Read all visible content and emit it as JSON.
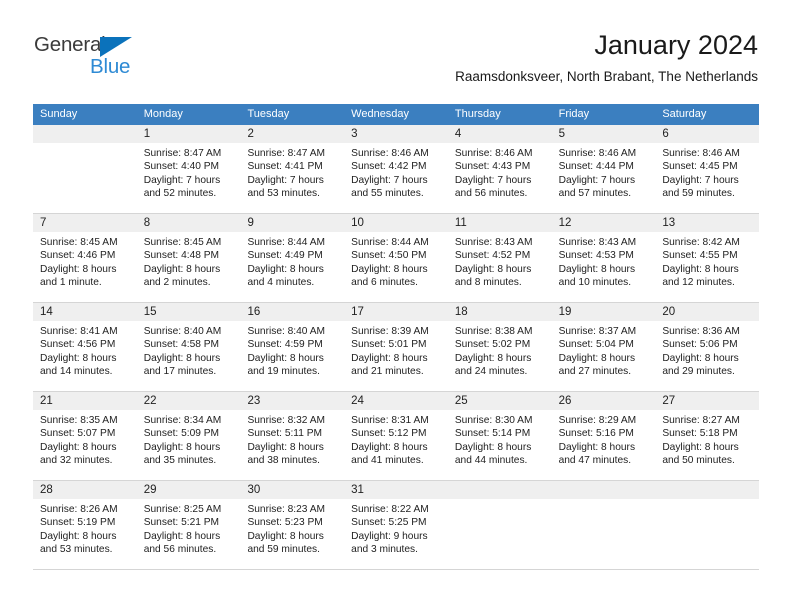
{
  "brand": {
    "name_part1": "General",
    "name_part2": "Blue",
    "color_dark": "#3b3b3b",
    "color_blue": "#2e8ad4",
    "triangle_color": "#0b72bb"
  },
  "header": {
    "title": "January 2024",
    "subtitle": "Raamsdonksveer, North Brabant, The Netherlands"
  },
  "calendar": {
    "header_bg": "#3b7fc0",
    "daynum_bg": "#efefef",
    "weekdays": [
      "Sunday",
      "Monday",
      "Tuesday",
      "Wednesday",
      "Thursday",
      "Friday",
      "Saturday"
    ],
    "weeks": [
      [
        {
          "day": "",
          "lines": []
        },
        {
          "day": "1",
          "lines": [
            "Sunrise: 8:47 AM",
            "Sunset: 4:40 PM",
            "Daylight: 7 hours",
            "and 52 minutes."
          ]
        },
        {
          "day": "2",
          "lines": [
            "Sunrise: 8:47 AM",
            "Sunset: 4:41 PM",
            "Daylight: 7 hours",
            "and 53 minutes."
          ]
        },
        {
          "day": "3",
          "lines": [
            "Sunrise: 8:46 AM",
            "Sunset: 4:42 PM",
            "Daylight: 7 hours",
            "and 55 minutes."
          ]
        },
        {
          "day": "4",
          "lines": [
            "Sunrise: 8:46 AM",
            "Sunset: 4:43 PM",
            "Daylight: 7 hours",
            "and 56 minutes."
          ]
        },
        {
          "day": "5",
          "lines": [
            "Sunrise: 8:46 AM",
            "Sunset: 4:44 PM",
            "Daylight: 7 hours",
            "and 57 minutes."
          ]
        },
        {
          "day": "6",
          "lines": [
            "Sunrise: 8:46 AM",
            "Sunset: 4:45 PM",
            "Daylight: 7 hours",
            "and 59 minutes."
          ]
        }
      ],
      [
        {
          "day": "7",
          "lines": [
            "Sunrise: 8:45 AM",
            "Sunset: 4:46 PM",
            "Daylight: 8 hours",
            "and 1 minute."
          ]
        },
        {
          "day": "8",
          "lines": [
            "Sunrise: 8:45 AM",
            "Sunset: 4:48 PM",
            "Daylight: 8 hours",
            "and 2 minutes."
          ]
        },
        {
          "day": "9",
          "lines": [
            "Sunrise: 8:44 AM",
            "Sunset: 4:49 PM",
            "Daylight: 8 hours",
            "and 4 minutes."
          ]
        },
        {
          "day": "10",
          "lines": [
            "Sunrise: 8:44 AM",
            "Sunset: 4:50 PM",
            "Daylight: 8 hours",
            "and 6 minutes."
          ]
        },
        {
          "day": "11",
          "lines": [
            "Sunrise: 8:43 AM",
            "Sunset: 4:52 PM",
            "Daylight: 8 hours",
            "and 8 minutes."
          ]
        },
        {
          "day": "12",
          "lines": [
            "Sunrise: 8:43 AM",
            "Sunset: 4:53 PM",
            "Daylight: 8 hours",
            "and 10 minutes."
          ]
        },
        {
          "day": "13",
          "lines": [
            "Sunrise: 8:42 AM",
            "Sunset: 4:55 PM",
            "Daylight: 8 hours",
            "and 12 minutes."
          ]
        }
      ],
      [
        {
          "day": "14",
          "lines": [
            "Sunrise: 8:41 AM",
            "Sunset: 4:56 PM",
            "Daylight: 8 hours",
            "and 14 minutes."
          ]
        },
        {
          "day": "15",
          "lines": [
            "Sunrise: 8:40 AM",
            "Sunset: 4:58 PM",
            "Daylight: 8 hours",
            "and 17 minutes."
          ]
        },
        {
          "day": "16",
          "lines": [
            "Sunrise: 8:40 AM",
            "Sunset: 4:59 PM",
            "Daylight: 8 hours",
            "and 19 minutes."
          ]
        },
        {
          "day": "17",
          "lines": [
            "Sunrise: 8:39 AM",
            "Sunset: 5:01 PM",
            "Daylight: 8 hours",
            "and 21 minutes."
          ]
        },
        {
          "day": "18",
          "lines": [
            "Sunrise: 8:38 AM",
            "Sunset: 5:02 PM",
            "Daylight: 8 hours",
            "and 24 minutes."
          ]
        },
        {
          "day": "19",
          "lines": [
            "Sunrise: 8:37 AM",
            "Sunset: 5:04 PM",
            "Daylight: 8 hours",
            "and 27 minutes."
          ]
        },
        {
          "day": "20",
          "lines": [
            "Sunrise: 8:36 AM",
            "Sunset: 5:06 PM",
            "Daylight: 8 hours",
            "and 29 minutes."
          ]
        }
      ],
      [
        {
          "day": "21",
          "lines": [
            "Sunrise: 8:35 AM",
            "Sunset: 5:07 PM",
            "Daylight: 8 hours",
            "and 32 minutes."
          ]
        },
        {
          "day": "22",
          "lines": [
            "Sunrise: 8:34 AM",
            "Sunset: 5:09 PM",
            "Daylight: 8 hours",
            "and 35 minutes."
          ]
        },
        {
          "day": "23",
          "lines": [
            "Sunrise: 8:32 AM",
            "Sunset: 5:11 PM",
            "Daylight: 8 hours",
            "and 38 minutes."
          ]
        },
        {
          "day": "24",
          "lines": [
            "Sunrise: 8:31 AM",
            "Sunset: 5:12 PM",
            "Daylight: 8 hours",
            "and 41 minutes."
          ]
        },
        {
          "day": "25",
          "lines": [
            "Sunrise: 8:30 AM",
            "Sunset: 5:14 PM",
            "Daylight: 8 hours",
            "and 44 minutes."
          ]
        },
        {
          "day": "26",
          "lines": [
            "Sunrise: 8:29 AM",
            "Sunset: 5:16 PM",
            "Daylight: 8 hours",
            "and 47 minutes."
          ]
        },
        {
          "day": "27",
          "lines": [
            "Sunrise: 8:27 AM",
            "Sunset: 5:18 PM",
            "Daylight: 8 hours",
            "and 50 minutes."
          ]
        }
      ],
      [
        {
          "day": "28",
          "lines": [
            "Sunrise: 8:26 AM",
            "Sunset: 5:19 PM",
            "Daylight: 8 hours",
            "and 53 minutes."
          ]
        },
        {
          "day": "29",
          "lines": [
            "Sunrise: 8:25 AM",
            "Sunset: 5:21 PM",
            "Daylight: 8 hours",
            "and 56 minutes."
          ]
        },
        {
          "day": "30",
          "lines": [
            "Sunrise: 8:23 AM",
            "Sunset: 5:23 PM",
            "Daylight: 8 hours",
            "and 59 minutes."
          ]
        },
        {
          "day": "31",
          "lines": [
            "Sunrise: 8:22 AM",
            "Sunset: 5:25 PM",
            "Daylight: 9 hours",
            "and 3 minutes."
          ]
        },
        {
          "day": "",
          "lines": []
        },
        {
          "day": "",
          "lines": []
        },
        {
          "day": "",
          "lines": []
        }
      ]
    ]
  }
}
